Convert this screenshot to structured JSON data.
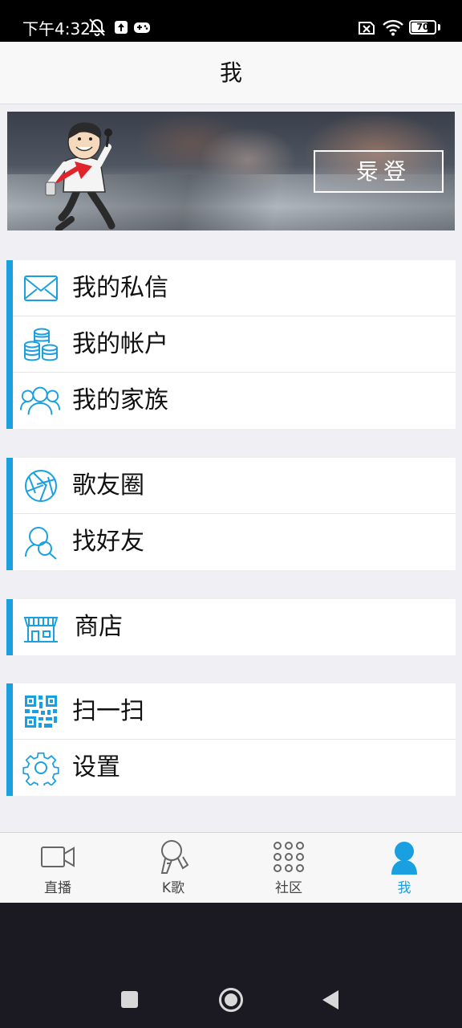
{
  "status_bar": {
    "time": "下午4:32",
    "battery": "70",
    "battery_level": 0.7
  },
  "header": {
    "title": "我"
  },
  "banner": {
    "login_label": "登录"
  },
  "menu_groups": [
    {
      "items": [
        {
          "icon": "mail-icon",
          "label": "我的私信"
        },
        {
          "icon": "coins-icon",
          "label": "我的帐户"
        },
        {
          "icon": "family-icon",
          "label": "我的家族"
        }
      ]
    },
    {
      "items": [
        {
          "icon": "aperture-icon",
          "label": "歌友圈"
        },
        {
          "icon": "find-friend-icon",
          "label": "找好友"
        }
      ]
    },
    {
      "items": [
        {
          "icon": "store-icon",
          "label": "商店"
        }
      ]
    },
    {
      "items": [
        {
          "icon": "qr-code-icon",
          "label": "扫一扫"
        },
        {
          "icon": "gear-icon",
          "label": "设置"
        }
      ]
    }
  ],
  "tab_bar": {
    "tabs": [
      {
        "icon": "video-camera-icon",
        "label": "直播"
      },
      {
        "icon": "microphone-icon",
        "label": "K歌"
      },
      {
        "icon": "grid-dots-icon",
        "label": "社区"
      },
      {
        "icon": "user-icon",
        "label": "我"
      }
    ],
    "active_index": 3
  },
  "colors": {
    "accent": "#1aa0e0",
    "background": "#efeff4",
    "status_bar": "#000000",
    "system_nav": "#1b1a22"
  }
}
